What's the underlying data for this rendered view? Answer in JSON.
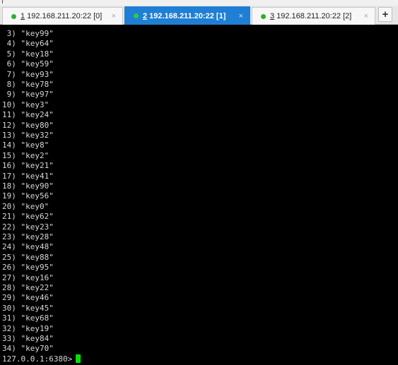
{
  "tabs": [
    {
      "number": "1",
      "host": " 192.168.211.20:22 [0]",
      "active": false,
      "status_color": "#2db12d"
    },
    {
      "number": "2",
      "host": " 192.168.211.20:22 [1]",
      "active": true,
      "status_color": "#2ecc40"
    },
    {
      "number": "3",
      "host": " 192.168.211.20:22 [2]",
      "active": false,
      "status_color": "#2db12d"
    }
  ],
  "tab_close_glyph": "×",
  "new_tab_label": "+",
  "terminal": {
    "lines": [
      " 3) \"key99\"",
      " 4) \"key64\"",
      " 5) \"key18\"",
      " 6) \"key59\"",
      " 7) \"key93\"",
      " 8) \"key78\"",
      " 9) \"key97\"",
      "10) \"key3\"",
      "11) \"key24\"",
      "12) \"key80\"",
      "13) \"key32\"",
      "14) \"key8\"",
      "15) \"key2\"",
      "16) \"key21\"",
      "17) \"key41\"",
      "18) \"key90\"",
      "19) \"key56\"",
      "20) \"key0\"",
      "21) \"key62\"",
      "22) \"key23\"",
      "23) \"key28\"",
      "24) \"key48\"",
      "25) \"key88\"",
      "26) \"key95\"",
      "27) \"key16\"",
      "28) \"key22\"",
      "29) \"key46\"",
      "30) \"key45\"",
      "31) \"key68\"",
      "32) \"key19\"",
      "33) \"key84\"",
      "34) \"key70\""
    ],
    "prompt": "127.0.0.1:6380>",
    "cursor_color": "#00e000",
    "text_color": "#d8d8d8",
    "background": "#000000"
  }
}
